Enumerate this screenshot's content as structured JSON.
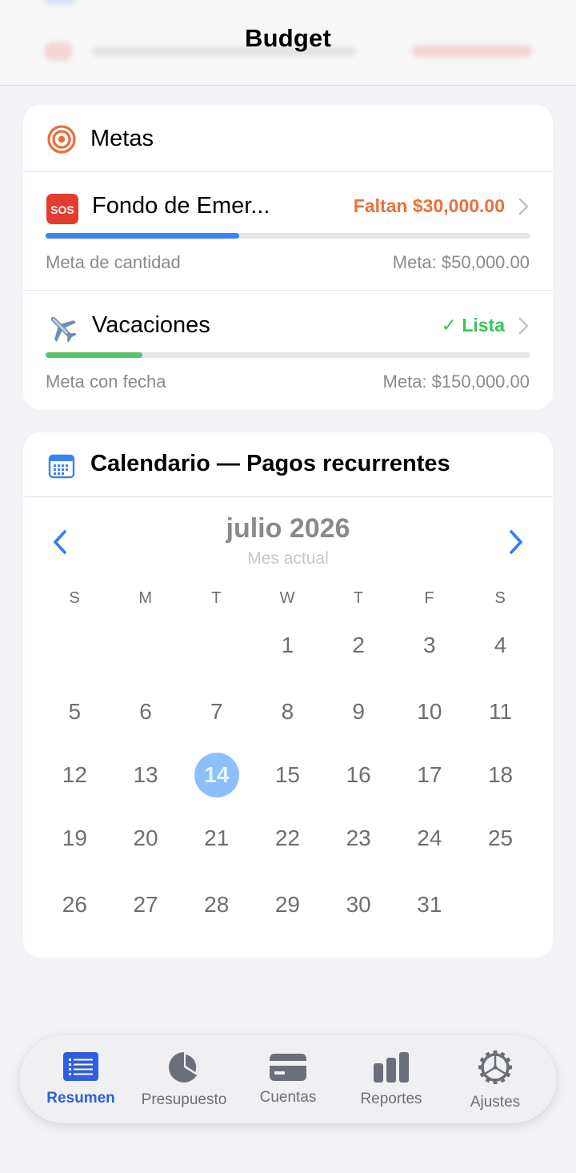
{
  "app": {
    "title": "Budget"
  },
  "goals": {
    "title": "Metas",
    "icon": "target-icon",
    "items": [
      {
        "icon": "sos-icon",
        "name": "Fondo de Emer...",
        "status": "Faltan $30,000.00",
        "status_color": "#e8713a",
        "progress": 0.4,
        "progress_color": "#3b82f6",
        "type": "Meta de cantidad",
        "target": "Meta: $50,000.00"
      },
      {
        "icon": "airplane-icon",
        "name": "Vacaciones",
        "status": "✓ Lista",
        "status_color": "#34c759",
        "progress": 0.2,
        "progress_color": "#5ac26a",
        "type": "Meta con fecha",
        "target": "Meta: $150,000.00"
      }
    ]
  },
  "calendar": {
    "title": "Calendario — Pagos recurrentes",
    "icon": "calendar-icon",
    "month": "julio 2026",
    "month_sub": "Mes actual",
    "weekdays": [
      "S",
      "M",
      "T",
      "W",
      "T",
      "F",
      "S"
    ],
    "weeks": [
      [
        "",
        "",
        "",
        "1",
        "2",
        "3",
        "4"
      ],
      [
        "5",
        "6",
        "7",
        "8",
        "9",
        "10",
        "11"
      ],
      [
        "12",
        "13",
        "14",
        "15",
        "16",
        "17",
        "18"
      ],
      [
        "19",
        "20",
        "21",
        "22",
        "23",
        "24",
        "25"
      ],
      [
        "26",
        "27",
        "28",
        "29",
        "30",
        "31",
        ""
      ]
    ],
    "today": "14"
  },
  "tabbar": {
    "active": 0,
    "tabs": [
      {
        "label": "Resumen",
        "icon": "list-icon"
      },
      {
        "label": "Presupuesto",
        "icon": "pie-chart-icon"
      },
      {
        "label": "Cuentas",
        "icon": "card-icon"
      },
      {
        "label": "Reportes",
        "icon": "bar-chart-icon"
      },
      {
        "label": "Ajustes",
        "icon": "gear-icon"
      }
    ]
  },
  "colors": {
    "accent": "#2f7cf6",
    "tab_active": "#2f5fe0",
    "background": "#f2f2f7"
  }
}
